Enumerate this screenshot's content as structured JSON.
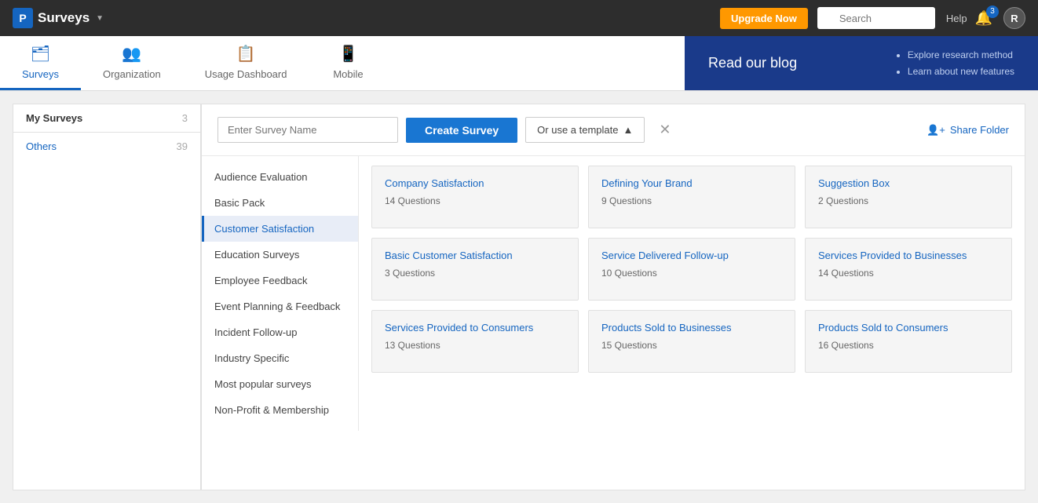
{
  "navbar": {
    "brand": "Surveys",
    "p_logo": "P",
    "upgrade_label": "Upgrade Now",
    "search_placeholder": "Search",
    "help_label": "Help",
    "notification_count": "3",
    "avatar_label": "R"
  },
  "tabs": {
    "items": [
      {
        "id": "surveys",
        "label": "Surveys",
        "icon": "🗂",
        "active": true
      },
      {
        "id": "organization",
        "label": "Organization",
        "icon": "👥",
        "active": false
      },
      {
        "id": "usage-dashboard",
        "label": "Usage Dashboard",
        "icon": "📋",
        "active": false
      },
      {
        "id": "mobile",
        "label": "Mobile",
        "icon": "📱",
        "active": false
      }
    ],
    "blog": {
      "title": "Read our blog",
      "bullets": [
        "Explore research method",
        "Learn about new features"
      ]
    }
  },
  "sidebar": {
    "my_surveys_label": "My Surveys",
    "my_surveys_count": "3",
    "others_label": "Others",
    "others_count": "39"
  },
  "create_bar": {
    "input_placeholder": "Enter Survey Name",
    "create_btn_label": "Create Survey",
    "template_btn_label": "Or use a template",
    "share_folder_label": "Share Folder"
  },
  "categories": [
    {
      "id": "audience-evaluation",
      "label": "Audience Evaluation",
      "active": false
    },
    {
      "id": "basic-pack",
      "label": "Basic Pack",
      "active": false
    },
    {
      "id": "customer-satisfaction",
      "label": "Customer Satisfaction",
      "active": true
    },
    {
      "id": "education-surveys",
      "label": "Education Surveys",
      "active": false
    },
    {
      "id": "employee-feedback",
      "label": "Employee Feedback",
      "active": false
    },
    {
      "id": "event-planning",
      "label": "Event Planning & Feedback",
      "active": false
    },
    {
      "id": "incident-followup",
      "label": "Incident Follow-up",
      "active": false
    },
    {
      "id": "industry-specific",
      "label": "Industry Specific",
      "active": false
    },
    {
      "id": "most-popular",
      "label": "Most popular surveys",
      "active": false
    },
    {
      "id": "non-profit",
      "label": "Non-Profit & Membership",
      "active": false
    }
  ],
  "templates": [
    {
      "id": "company-satisfaction",
      "title": "Company Satisfaction",
      "questions": "14 Questions"
    },
    {
      "id": "defining-your-brand",
      "title": "Defining Your Brand",
      "questions": "9 Questions"
    },
    {
      "id": "suggestion-box",
      "title": "Suggestion Box",
      "questions": "2 Questions"
    },
    {
      "id": "basic-customer-satisfaction",
      "title": "Basic Customer Satisfaction",
      "questions": "3 Questions"
    },
    {
      "id": "service-delivered-followup",
      "title": "Service Delivered Follow-up",
      "questions": "10 Questions"
    },
    {
      "id": "services-provided-businesses",
      "title": "Services Provided to Businesses",
      "questions": "14 Questions"
    },
    {
      "id": "services-provided-consumers",
      "title": "Services Provided to Consumers",
      "questions": "13 Questions"
    },
    {
      "id": "products-sold-businesses",
      "title": "Products Sold to Businesses",
      "questions": "15 Questions"
    },
    {
      "id": "products-sold-consumers",
      "title": "Products Sold to Consumers",
      "questions": "16 Questions"
    }
  ]
}
